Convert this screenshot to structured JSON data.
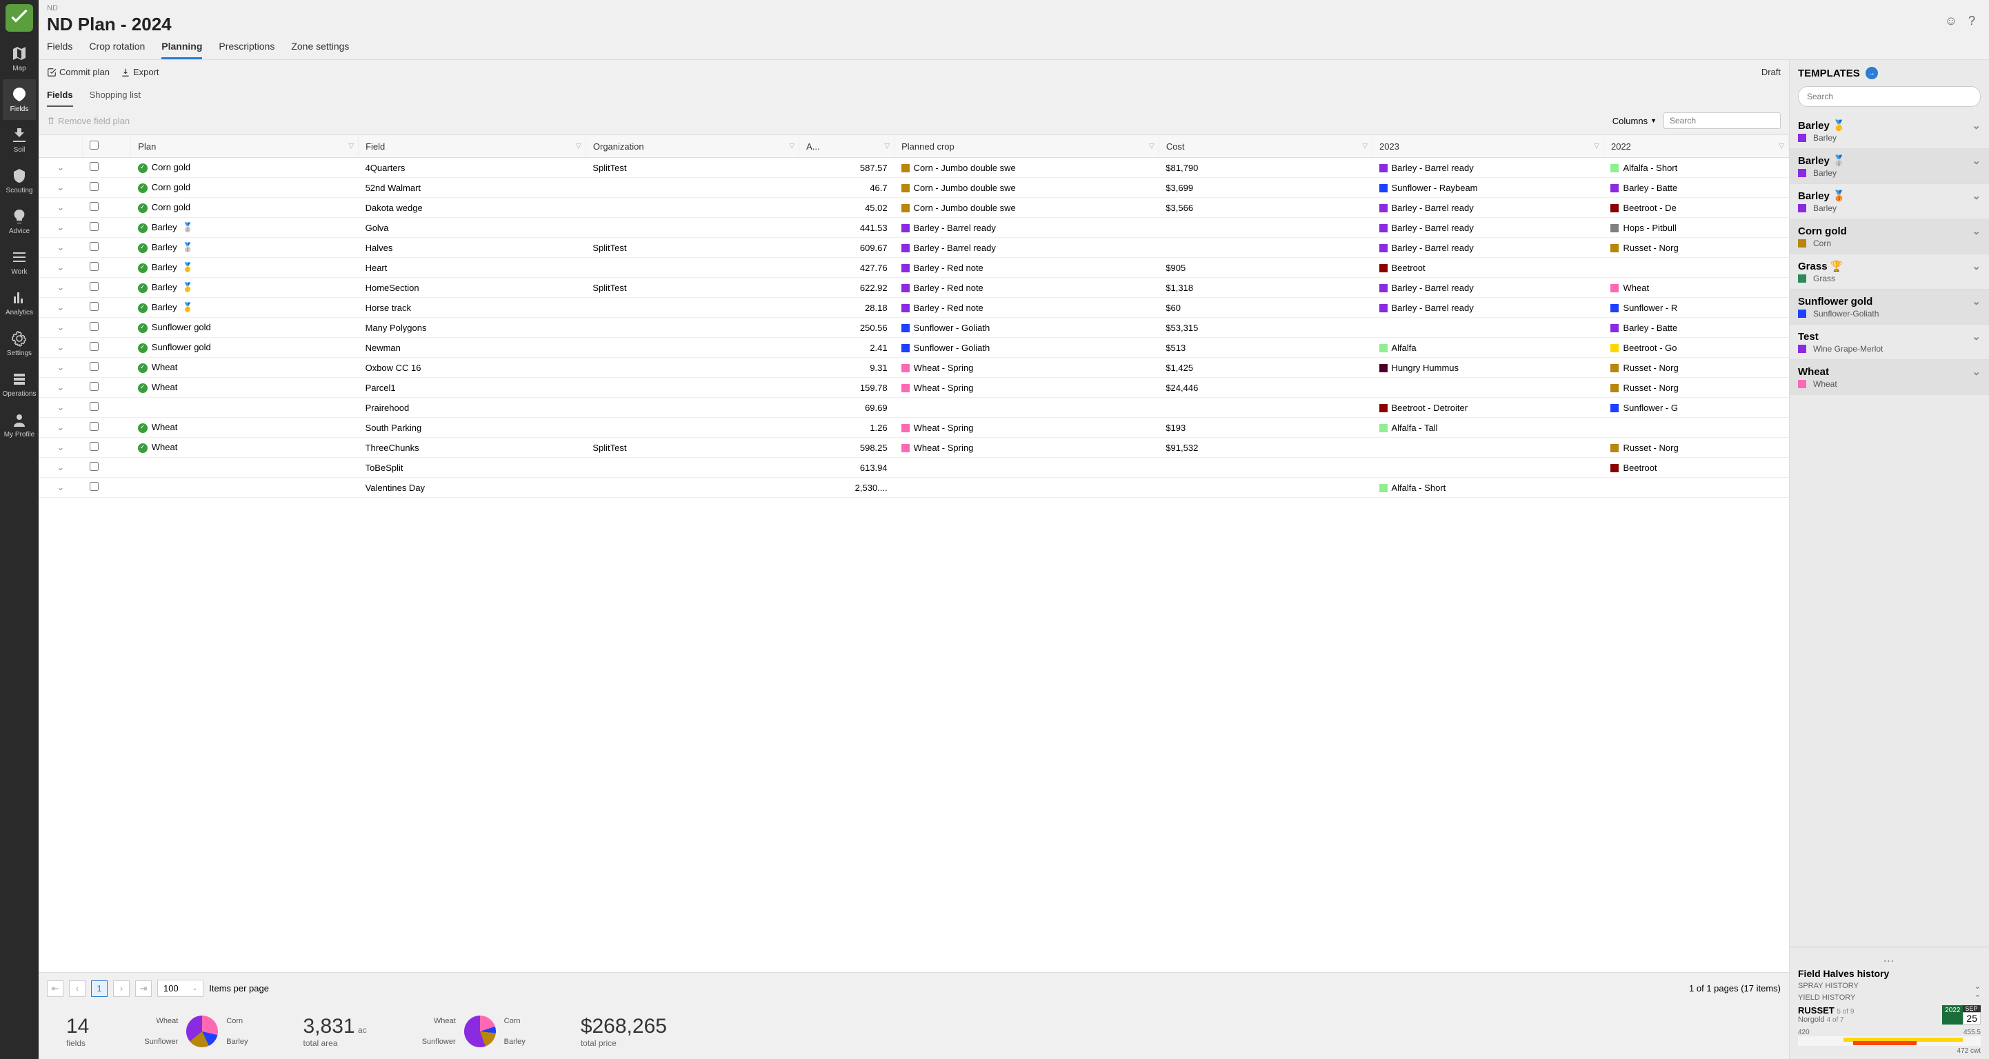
{
  "breadcrumb": "ND",
  "title": "ND Plan - 2024",
  "sidebar": {
    "items": [
      {
        "icon": "map",
        "label": "Map"
      },
      {
        "icon": "fields",
        "label": "Fields"
      },
      {
        "icon": "soil",
        "label": "Soil"
      },
      {
        "icon": "scouting",
        "label": "Scouting"
      },
      {
        "icon": "advice",
        "label": "Advice"
      },
      {
        "icon": "work",
        "label": "Work"
      },
      {
        "icon": "analytics",
        "label": "Analytics"
      },
      {
        "icon": "settings",
        "label": "Settings"
      },
      {
        "icon": "operations",
        "label": "Operations"
      },
      {
        "icon": "profile",
        "label": "My Profile"
      }
    ]
  },
  "tabs": [
    "Fields",
    "Crop rotation",
    "Planning",
    "Prescriptions",
    "Zone settings"
  ],
  "active_tab": "Planning",
  "toolbar": {
    "commit": "Commit plan",
    "export": "Export",
    "status": "Draft"
  },
  "subtabs": [
    "Fields",
    "Shopping list"
  ],
  "active_subtab": "Fields",
  "remove_label": "Remove field plan",
  "columns_label": "Columns",
  "search_placeholder": "Search",
  "table": {
    "headers": [
      "Plan",
      "Field",
      "Organization",
      "A...",
      "Planned crop",
      "Cost",
      "2023",
      "2022"
    ],
    "rows": [
      {
        "plan": "Corn gold",
        "medal": "",
        "field": "4Quarters",
        "org": "SplitTest",
        "area": "587.57",
        "crop": "Corn - Jumbo double swe",
        "crop_c": "#b8860b",
        "cost": "$81,790",
        "y2023": "Barley - Barrel ready",
        "c23": "#8a2be2",
        "y2022": "Alfalfa - Short",
        "c22": "#90ee90"
      },
      {
        "plan": "Corn gold",
        "medal": "",
        "field": "52nd Walmart",
        "org": "",
        "area": "46.7",
        "crop": "Corn - Jumbo double swe",
        "crop_c": "#b8860b",
        "cost": "$3,699",
        "y2023": "Sunflower - Raybeam",
        "c23": "#1e40ff",
        "y2022": "Barley - Batte",
        "c22": "#8a2be2"
      },
      {
        "plan": "Corn gold",
        "medal": "",
        "field": "Dakota wedge",
        "org": "",
        "area": "45.02",
        "crop": "Corn - Jumbo double swe",
        "crop_c": "#b8860b",
        "cost": "$3,566",
        "y2023": "Barley - Barrel ready",
        "c23": "#8a2be2",
        "y2022": "Beetroot - De",
        "c22": "#8b0000"
      },
      {
        "plan": "Barley",
        "medal": "🥈",
        "field": "Golva",
        "org": "",
        "area": "441.53",
        "crop": "Barley - Barrel ready",
        "crop_c": "#8a2be2",
        "cost": "",
        "y2023": "Barley - Barrel ready",
        "c23": "#8a2be2",
        "y2022": "Hops - Pitbull",
        "c22": "#808080"
      },
      {
        "plan": "Barley",
        "medal": "🥈",
        "field": "Halves",
        "org": "SplitTest",
        "area": "609.67",
        "crop": "Barley - Barrel ready",
        "crop_c": "#8a2be2",
        "cost": "",
        "y2023": "Barley - Barrel ready",
        "c23": "#8a2be2",
        "y2022": "Russet - Norg",
        "c22": "#b8860b"
      },
      {
        "plan": "Barley",
        "medal": "🥇",
        "field": "Heart",
        "org": "",
        "area": "427.76",
        "crop": "Barley - Red note",
        "crop_c": "#8a2be2",
        "cost": "$905",
        "y2023": "Beetroot",
        "c23": "#8b0000",
        "y2022": "",
        "c22": ""
      },
      {
        "plan": "Barley",
        "medal": "🥇",
        "field": "HomeSection",
        "org": "SplitTest",
        "area": "622.92",
        "crop": "Barley - Red note",
        "crop_c": "#8a2be2",
        "cost": "$1,318",
        "y2023": "Barley - Barrel ready",
        "c23": "#8a2be2",
        "y2022": "Wheat",
        "c22": "#ff69b4"
      },
      {
        "plan": "Barley",
        "medal": "🥇",
        "field": "Horse track",
        "org": "",
        "area": "28.18",
        "crop": "Barley - Red note",
        "crop_c": "#8a2be2",
        "cost": "$60",
        "y2023": "Barley - Barrel ready",
        "c23": "#8a2be2",
        "y2022": "Sunflower - R",
        "c22": "#1e40ff"
      },
      {
        "plan": "Sunflower gold",
        "medal": "",
        "field": "Many Polygons",
        "org": "",
        "area": "250.56",
        "crop": "Sunflower - Goliath",
        "crop_c": "#1e40ff",
        "cost": "$53,315",
        "y2023": "",
        "c23": "",
        "y2022": "Barley - Batte",
        "c22": "#8a2be2"
      },
      {
        "plan": "Sunflower gold",
        "medal": "",
        "field": "Newman",
        "org": "",
        "area": "2.41",
        "crop": "Sunflower - Goliath",
        "crop_c": "#1e40ff",
        "cost": "$513",
        "y2023": "Alfalfa",
        "c23": "#90ee90",
        "y2022": "Beetroot - Go",
        "c22": "#ffd700"
      },
      {
        "plan": "Wheat",
        "medal": "",
        "field": "Oxbow CC 16",
        "org": "",
        "area": "9.31",
        "crop": "Wheat - Spring",
        "crop_c": "#ff69b4",
        "cost": "$1,425",
        "y2023": "Hungry Hummus",
        "c23": "#4b0029",
        "y2022": "Russet - Norg",
        "c22": "#b8860b"
      },
      {
        "plan": "Wheat",
        "medal": "",
        "field": "Parcel1",
        "org": "",
        "area": "159.78",
        "crop": "Wheat - Spring",
        "crop_c": "#ff69b4",
        "cost": "$24,446",
        "y2023": "",
        "c23": "",
        "y2022": "Russet - Norg",
        "c22": "#b8860b"
      },
      {
        "plan": "",
        "medal": "",
        "field": "Prairehood",
        "org": "",
        "area": "69.69",
        "crop": "",
        "crop_c": "",
        "cost": "",
        "y2023": "Beetroot - Detroiter",
        "c23": "#8b0000",
        "y2022": "Sunflower - G",
        "c22": "#1e40ff"
      },
      {
        "plan": "Wheat",
        "medal": "",
        "field": "South Parking",
        "org": "",
        "area": "1.26",
        "crop": "Wheat - Spring",
        "crop_c": "#ff69b4",
        "cost": "$193",
        "y2023": "Alfalfa - Tall",
        "c23": "#90ee90",
        "y2022": "",
        "c22": ""
      },
      {
        "plan": "Wheat",
        "medal": "",
        "field": "ThreeChunks",
        "org": "SplitTest",
        "area": "598.25",
        "crop": "Wheat - Spring",
        "crop_c": "#ff69b4",
        "cost": "$91,532",
        "y2023": "",
        "c23": "",
        "y2022": "Russet - Norg",
        "c22": "#b8860b"
      },
      {
        "plan": "",
        "medal": "",
        "field": "ToBeSplit",
        "org": "",
        "area": "613.94",
        "crop": "",
        "crop_c": "",
        "cost": "",
        "y2023": "",
        "c23": "",
        "y2022": "Beetroot",
        "c22": "#8b0000"
      },
      {
        "plan": "",
        "medal": "",
        "field": "Valentines Day",
        "org": "",
        "area": "2,530....",
        "crop": "",
        "crop_c": "",
        "cost": "",
        "y2023": "Alfalfa - Short",
        "c23": "#90ee90",
        "y2022": "",
        "c22": ""
      }
    ]
  },
  "pagination": {
    "current": "1",
    "page_size": "100",
    "items_label": "Items per page",
    "info": "1 of 1 pages (17 items)"
  },
  "summary": {
    "fields_count": "14",
    "fields_label": "fields",
    "area_value": "3,831",
    "area_unit": "ac",
    "area_label": "total area",
    "price_value": "$268,265",
    "price_label": "total price",
    "pie_labels": [
      "Wheat",
      "Sunflower",
      "Corn",
      "Barley"
    ]
  },
  "chart_data": [
    {
      "type": "pie",
      "title": "fields by crop",
      "series": [
        {
          "name": "Wheat",
          "value": 4,
          "color": "#ff69b4"
        },
        {
          "name": "Sunflower",
          "value": 2,
          "color": "#1e40ff"
        },
        {
          "name": "Corn",
          "value": 3,
          "color": "#b8860b"
        },
        {
          "name": "Barley",
          "value": 5,
          "color": "#8a2be2"
        }
      ]
    },
    {
      "type": "pie",
      "title": "area by crop",
      "series": [
        {
          "name": "Wheat",
          "value": 768,
          "color": "#ff69b4"
        },
        {
          "name": "Sunflower",
          "value": 253,
          "color": "#1e40ff"
        },
        {
          "name": "Corn",
          "value": 679,
          "color": "#b8860b"
        },
        {
          "name": "Barley",
          "value": 2130,
          "color": "#8a2be2"
        }
      ]
    }
  ],
  "templates": {
    "title": "TEMPLATES",
    "search_placeholder": "Search",
    "items": [
      {
        "name": "Barley",
        "medal": "🥇",
        "sub": "Barley",
        "sub_c": "#8a2be2",
        "alt": false
      },
      {
        "name": "Barley",
        "medal": "🥈",
        "sub": "Barley",
        "sub_c": "#8a2be2",
        "alt": true
      },
      {
        "name": "Barley",
        "medal": "🥉",
        "sub": "Barley",
        "sub_c": "#8a2be2",
        "alt": false
      },
      {
        "name": "Corn gold",
        "medal": "",
        "sub": "Corn",
        "sub_c": "#b8860b",
        "alt": true
      },
      {
        "name": "Grass",
        "medal": "🏆",
        "sub": "Grass",
        "sub_c": "#2e8b57",
        "alt": false
      },
      {
        "name": "Sunflower gold",
        "medal": "",
        "sub": "Sunflower-Goliath",
        "sub_c": "#1e40ff",
        "alt": true
      },
      {
        "name": "Test",
        "medal": "",
        "sub": "Wine Grape-Merlot",
        "sub_c": "#8a2be2",
        "alt": false
      },
      {
        "name": "Wheat",
        "medal": "",
        "sub": "Wheat",
        "sub_c": "#ff69b4",
        "alt": true
      }
    ]
  },
  "history": {
    "title": "Field Halves history",
    "spray": "SPRAY HISTORY",
    "yield": "YIELD HISTORY",
    "crop1": "RUSSET",
    "crop1_sub": "5 of 9",
    "crop2": "Norgold",
    "crop2_sub": "4 of 7",
    "year": "2022",
    "month": "SEP",
    "day": "25",
    "range_low": "420",
    "range_high": "455.5",
    "unit": "472 cwt"
  }
}
